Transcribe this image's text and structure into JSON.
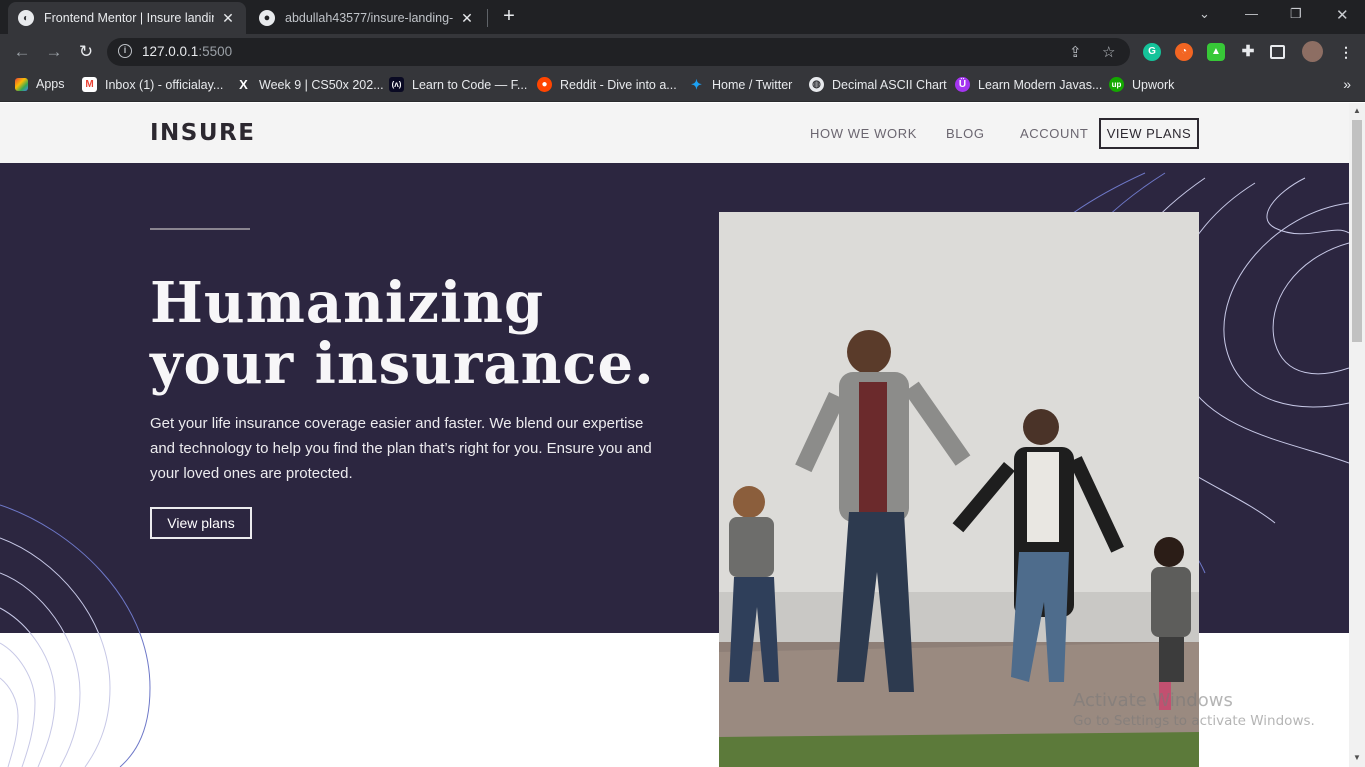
{
  "browser": {
    "tabs": [
      {
        "title": "Frontend Mentor | Insure landing",
        "icon": "frontend-mentor-icon"
      },
      {
        "title": "abdullah43577/insure-landing-pa",
        "icon": "github-icon"
      }
    ],
    "url_host": "127.0.0.1",
    "url_port": ":5500",
    "bookmarks": [
      {
        "label": "Apps",
        "icon": "apps-grid-icon"
      },
      {
        "label": "Inbox (1) - officialay...",
        "icon": "gmail-icon"
      },
      {
        "label": "Week 9 | CS50x 202...",
        "icon": "edx-icon"
      },
      {
        "label": "Learn to Code — F...",
        "icon": "freecodecamp-icon"
      },
      {
        "label": "Reddit - Dive into a...",
        "icon": "reddit-icon"
      },
      {
        "label": "Home / Twitter",
        "icon": "twitter-icon"
      },
      {
        "label": "Decimal ASCII Chart",
        "icon": "globe-icon"
      },
      {
        "label": "Learn Modern Javas...",
        "icon": "udemy-icon"
      },
      {
        "label": "Upwork",
        "icon": "upwork-icon"
      }
    ],
    "extensions": [
      "grammarly-icon",
      "rss-icon",
      "extension-icon",
      "puzzle-icon",
      "sidebar-icon",
      "profile-avatar"
    ]
  },
  "site": {
    "logo": "INSURE",
    "nav": {
      "how_we_work": "HOW WE WORK",
      "blog": "BLOG",
      "account": "ACCOUNT",
      "view_plans": "VIEW PLANS"
    },
    "hero": {
      "title_line1": "Humanizing",
      "title_line2": "your insurance.",
      "description": "Get your life insurance coverage easier and faster. We blend our expertise and technology to help you find the plan that’s right for you. Ensure you and your loved ones are protected.",
      "cta": "View plans"
    }
  },
  "os": {
    "watermark_line1": "Activate Windows",
    "watermark_line2": "Go to Settings to activate Windows."
  },
  "colors": {
    "hero_bg": "#2c2640",
    "header_bg": "#f4f4f4",
    "text_dark": "#2c2830",
    "curve_stroke": "#6e78c8"
  }
}
